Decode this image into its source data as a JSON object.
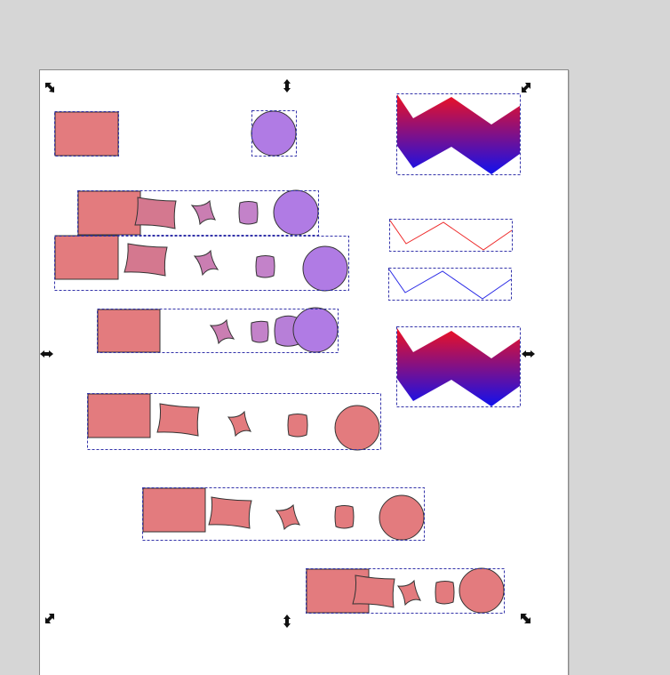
{
  "app": {
    "view": "canvas"
  },
  "colors": {
    "canvas_bg": "#d6d6d6",
    "page_bg": "#ffffff",
    "rect_fill": "#e37b7e",
    "blend_fill_1": "#d4788f",
    "blend_fill_2": "#ca7eb2",
    "blend_fill_3": "#c382c9",
    "circle_purple": "#b07be4",
    "gradient_top": "#ee1122",
    "gradient_bottom": "#1111ee",
    "zigzag_red": "#ee2a2a",
    "zigzag_blue": "#2a2ae6",
    "bbox_dash": "#3333aa",
    "outline": "#333333"
  },
  "selection": {
    "handles": [
      "scale-handle-top-left",
      "scale-handle-top",
      "scale-handle-top-right",
      "scale-handle-left",
      "scale-handle-right",
      "scale-handle-bottom-left",
      "scale-handle-bottom",
      "scale-handle-bottom-right"
    ]
  },
  "objects": [
    {
      "name": "source-rect",
      "kind": "rectangle"
    },
    {
      "name": "source-circle",
      "kind": "circle"
    },
    {
      "name": "gradient-zigzag-top",
      "kind": "gradient-path"
    },
    {
      "name": "blend-row-1",
      "kind": "blend-group",
      "steps": 5
    },
    {
      "name": "blend-row-2",
      "kind": "blend-group",
      "steps": 5
    },
    {
      "name": "blend-row-3",
      "kind": "blend-group",
      "steps": 5
    },
    {
      "name": "red-zigzag-line",
      "kind": "stroke-path"
    },
    {
      "name": "blue-zigzag-line",
      "kind": "stroke-path"
    },
    {
      "name": "gradient-zigzag-bottom",
      "kind": "gradient-path"
    },
    {
      "name": "blend-row-4",
      "kind": "blend-group",
      "steps": 5
    },
    {
      "name": "blend-row-5",
      "kind": "blend-group",
      "steps": 5
    },
    {
      "name": "blend-row-6",
      "kind": "blend-group",
      "steps": 5
    }
  ]
}
